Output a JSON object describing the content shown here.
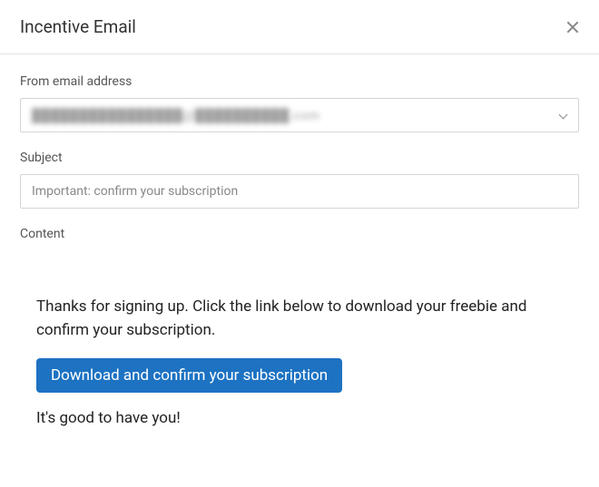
{
  "header": {
    "title": "Incentive Email"
  },
  "form": {
    "from_label": "From email address",
    "from_value": "████████████████@██████████.com",
    "subject_label": "Subject",
    "subject_value": "Important: confirm your subscription",
    "content_label": "Content"
  },
  "content": {
    "intro": "Thanks for signing up. Click the link below to download your freebie and confirm your subscription.",
    "button_label": "Download and confirm your subscription",
    "closing": "It's good to have you!"
  }
}
